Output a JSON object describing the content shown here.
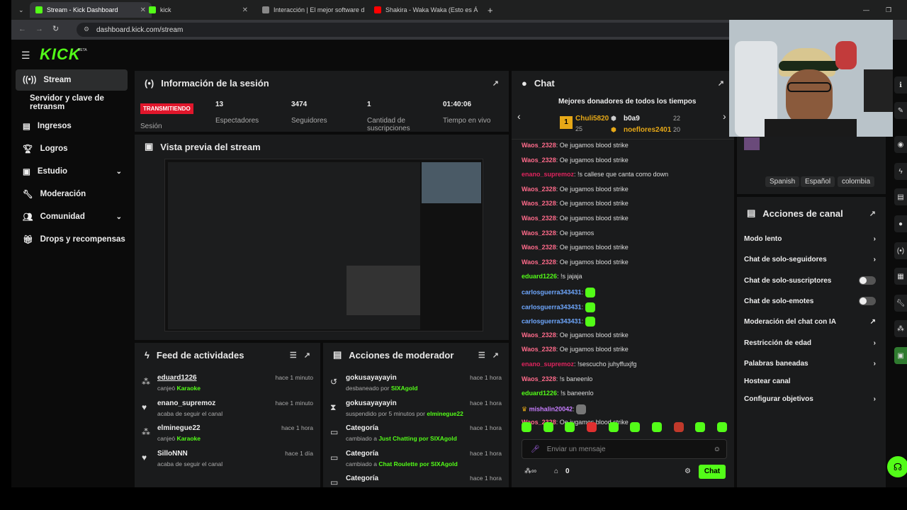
{
  "browser": {
    "tabs": [
      {
        "label": "Stream - Kick Dashboard",
        "color": "#53fc18"
      },
      {
        "label": "kick",
        "color": "#53fc18"
      },
      {
        "label": "Interacción | El mejor software d",
        "color": "#888888"
      },
      {
        "label": "Shakira - Waka Waka (Esto es Á",
        "color": "#ff0000"
      }
    ],
    "url": "dashboard.kick.com/stream"
  },
  "brand": {
    "logo": "KICK",
    "beta": "BETA",
    "accent": "#53fc18"
  },
  "sidebar": {
    "items": [
      {
        "label": "Stream",
        "icon": "broadcast-icon"
      },
      {
        "label": "Servidor y clave de retransm",
        "icon": ""
      },
      {
        "label": "Ingresos",
        "icon": "chart-icon"
      },
      {
        "label": "Logros",
        "icon": "trophy-icon"
      },
      {
        "label": "Estudio",
        "icon": "studio-icon"
      },
      {
        "label": "Moderación",
        "icon": "wrench-icon"
      },
      {
        "label": "Comunidad",
        "icon": "people-icon"
      },
      {
        "label": "Drops y recompensas",
        "icon": "gift-icon"
      }
    ]
  },
  "session": {
    "title": "Información de la sesión",
    "status_badge": "TRANSMITIENDO",
    "status_label": "Sesión",
    "stats": [
      {
        "value": "13",
        "label": "Espectadores"
      },
      {
        "value": "3474",
        "label": "Seguidores"
      },
      {
        "value": "1",
        "label": "Cantidad de suscripciones"
      },
      {
        "value": "01:40:06",
        "label": "Tiempo en vivo"
      }
    ]
  },
  "preview": {
    "title": "Vista previa del stream"
  },
  "activity": {
    "title": "Feed de actividades",
    "items": [
      {
        "name": "eduard1226",
        "sub_pre": "canjeó",
        "sub_hl": "Karaoke",
        "time": "hace 1 minuto",
        "icon": "redeem-icon"
      },
      {
        "name": "enano_supremoz",
        "sub_pre": "acaba de seguir el canal",
        "sub_hl": "",
        "time": "hace 1 minuto",
        "icon": "heart-icon"
      },
      {
        "name": "elminegue22",
        "sub_pre": "canjeó",
        "sub_hl": "Karaoke",
        "time": "hace 1 hora",
        "icon": "redeem-icon"
      },
      {
        "name": "SilloNNN",
        "sub_pre": "acaba de seguir el canal",
        "sub_hl": "",
        "time": "hace 1 día",
        "icon": "heart-icon"
      }
    ]
  },
  "modactions": {
    "title": "Acciones de moderador",
    "items": [
      {
        "name": "gokusayayayin",
        "sub_pre": "desbaneado por",
        "sub_hl": "SIXAgold",
        "time": "hace 1 hora",
        "icon": "undo-icon"
      },
      {
        "name": "gokusayayayin",
        "sub_pre": "suspendido por 5 minutos por",
        "sub_hl": "elminegue22",
        "time": "hace 1 hora",
        "icon": "hourglass-icon"
      },
      {
        "name": "Categoría",
        "sub_pre": "cambiado a",
        "sub_hl": "Just Chatting por SIXAgold",
        "time": "hace 1 hora",
        "icon": "category-icon"
      },
      {
        "name": "Categoría",
        "sub_pre": "cambiado a",
        "sub_hl": "Chat Roulette por SIXAgold",
        "time": "hace 1 hora",
        "icon": "category-icon"
      },
      {
        "name": "Categoría",
        "sub_pre": "",
        "sub_hl": "",
        "time": "hace 1 hora",
        "icon": "category-icon"
      }
    ]
  },
  "chat": {
    "title": "Chat",
    "donors_title": "Mejores donadores de todos los tiempos",
    "donors": [
      {
        "rank": "1",
        "name": "Chuli5820",
        "amount": "25"
      },
      {
        "rank": "",
        "name": "b0a9",
        "amount": "22"
      },
      {
        "rank": "",
        "name": "noeflores2401",
        "amount": "20"
      }
    ],
    "messages": [
      {
        "user": "Waos_2328",
        "text": "Oe jugamos blood strike",
        "color": "#ff6b8b"
      },
      {
        "user": "Waos_2328",
        "text": "Oe jugamos blood strike",
        "color": "#ff6b8b"
      },
      {
        "user": "enano_supremoz",
        "text": "!s callese que canta como down",
        "color": "#e0245e"
      },
      {
        "user": "Waos_2328",
        "text": "Oe jugamos blood strike",
        "color": "#ff6b8b"
      },
      {
        "user": "Waos_2328",
        "text": "Oe jugamos blood strike",
        "color": "#ff6b8b"
      },
      {
        "user": "Waos_2328",
        "text": "Oe jugamos blood strike",
        "color": "#ff6b8b"
      },
      {
        "user": "Waos_2328",
        "text": "Oe jugamos",
        "color": "#ff6b8b"
      },
      {
        "user": "Waos_2328",
        "text": "Oe jugamos blood strike",
        "color": "#ff6b8b"
      },
      {
        "user": "Waos_2328",
        "text": "Oe jugamos blood strike",
        "color": "#ff6b8b"
      },
      {
        "user": "eduard1226",
        "text": "!s jajaja",
        "color": "#53fc18"
      },
      {
        "user": "carlosguerra343431",
        "text": "",
        "color": "#6fa8ff"
      },
      {
        "user": "carlosguerra343431",
        "text": "",
        "color": "#6fa8ff"
      },
      {
        "user": "carlosguerra343431",
        "text": "",
        "color": "#6fa8ff"
      },
      {
        "user": "Waos_2328",
        "text": "Oe jugamos blood strike",
        "color": "#ff6b8b"
      },
      {
        "user": "Waos_2328",
        "text": "Oe jugamos blood strike",
        "color": "#ff6b8b"
      },
      {
        "user": "enano_supremoz",
        "text": "!sescucho juhyffuxjfg",
        "color": "#e0245e"
      },
      {
        "user": "Waos_2328",
        "text": "!s baneenlo",
        "color": "#ff6b8b"
      },
      {
        "user": "eduard1226",
        "text": "!s baneenlo",
        "color": "#53fc18"
      },
      {
        "user": "mishalin20042",
        "text": "",
        "color": "#c77dff"
      },
      {
        "user": "Waos_2328",
        "text": "Oe jugamos blood strike",
        "color": "#ff6b8b"
      }
    ],
    "input_placeholder": "Enviar un mensaje",
    "points": "0",
    "send_label": "Chat"
  },
  "tags": [
    "Spanish",
    "Español",
    "colombia"
  ],
  "channel_actions": {
    "title": "Acciones de canal",
    "items": [
      {
        "label": "Modo lento",
        "kind": "chevron"
      },
      {
        "label": "Chat de solo-seguidores",
        "kind": "chevron"
      },
      {
        "label": "Chat de solo-suscriptores",
        "kind": "toggle"
      },
      {
        "label": "Chat de solo-emotes",
        "kind": "toggle"
      },
      {
        "label": "Moderación del chat con IA",
        "kind": "external"
      },
      {
        "label": "Restricción de edad",
        "kind": "chevron"
      },
      {
        "label": "Palabras baneadas",
        "kind": "chevron"
      },
      {
        "label": "Hostear canal",
        "kind": "none"
      },
      {
        "label": "Configurar objetivos",
        "kind": "chevron"
      }
    ]
  }
}
